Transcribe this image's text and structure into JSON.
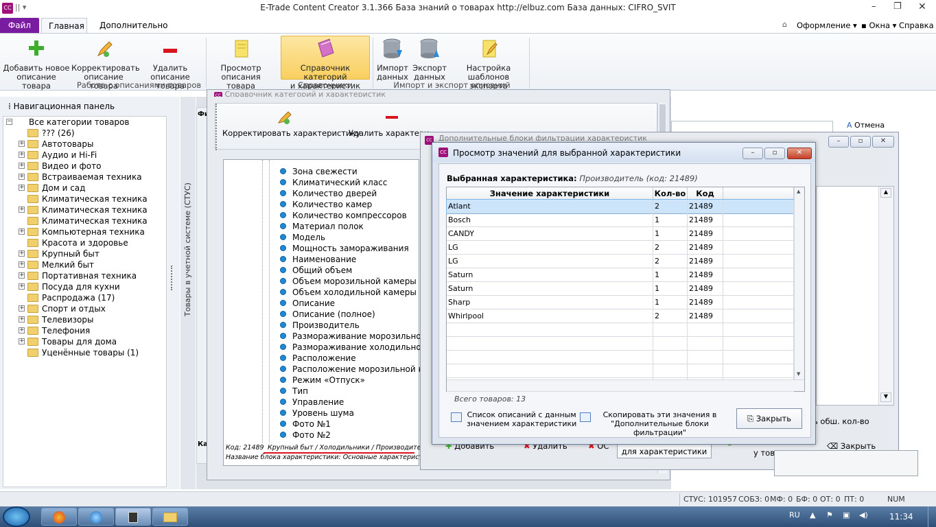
{
  "app": {
    "title": "E-Trade Content Creator 3.1.366     База знаний о товарах     http://elbuz.com     База данных: CIFRO_SVIT",
    "icon_text": "CC"
  },
  "ribbon_tabs": {
    "file": "Файл",
    "main": "Главная",
    "extra": "Дополнительно",
    "right": [
      "Оформление",
      "Окна",
      "Справка"
    ]
  },
  "ribbon": {
    "buttons": [
      {
        "label1": "Добавить новое",
        "label2": "описание товара",
        "icon": "plus-icon"
      },
      {
        "label1": "Корректировать",
        "label2": "описание товара",
        "icon": "pencil-icon"
      },
      {
        "label1": "Удалить",
        "label2": "описание товара",
        "icon": "minus-icon"
      },
      {
        "label1": "Просмотр",
        "label2": "описания товара",
        "icon": "document-icon"
      },
      {
        "label1": "Справочник категорий",
        "label2": "и характеристик",
        "icon": "book-icon"
      },
      {
        "label1": "Импорт",
        "label2": "данных",
        "icon": "database-import-icon"
      },
      {
        "label1": "Экспорт",
        "label2": "данных",
        "icon": "database-export-icon"
      },
      {
        "label1": "Настройка",
        "label2": "шаблонов экспорта",
        "icon": "template-icon"
      }
    ],
    "groups": [
      "Работа с описаниями товаров",
      "Справочники",
      "Импорт и экспорт описаний"
    ]
  },
  "nav": {
    "title": "Навигационная панель",
    "root": "Все категории товаров",
    "items": [
      {
        "label": "??? (26)",
        "expandable": false
      },
      {
        "label": "Автотовары",
        "expandable": true
      },
      {
        "label": "Аудио и Hi-Fi",
        "expandable": true
      },
      {
        "label": "Видео и фото",
        "expandable": true
      },
      {
        "label": "Встраиваемая техника",
        "expandable": true
      },
      {
        "label": "Дом и сад",
        "expandable": true
      },
      {
        "label": "Климатическая техника",
        "expandable": false
      },
      {
        "label": "Климатическая техника",
        "expandable": true
      },
      {
        "label": "Климатическая техника",
        "expandable": false
      },
      {
        "label": "Компьютерная техника",
        "expandable": true
      },
      {
        "label": "Красота и здоровье",
        "expandable": false
      },
      {
        "label": "Крупный быт",
        "expandable": true
      },
      {
        "label": "Мелкий быт",
        "expandable": true
      },
      {
        "label": "Портативная техника",
        "expandable": true
      },
      {
        "label": "Посуда для кухни",
        "expandable": true
      },
      {
        "label": "Распродажа (17)",
        "expandable": false
      },
      {
        "label": "Спорт и отдых",
        "expandable": true
      },
      {
        "label": "Телевизоры",
        "expandable": true
      },
      {
        "label": "Телефония",
        "expandable": true
      },
      {
        "label": "Товары для дома",
        "expandable": true
      },
      {
        "label": "Уценённые товары (1)",
        "expandable": false
      }
    ],
    "vertical_label": "Товары в учетной системе (СТУС)"
  },
  "sprav": {
    "title": "Справочник категорий и характеристик",
    "toolbar": [
      "Корректировать характеристику",
      "Удалить характери"
    ],
    "items": [
      "Зона свежести",
      "Климатический класс",
      "Количество дверей",
      "Количество камер",
      "Количество компрессоров",
      "Материал полок",
      "Модель",
      "Мощность замораживания",
      "Наименование",
      "Общий объем",
      "Объем морозильной камеры",
      "Объем холодильной камеры",
      "Описание",
      "Описание (полное)",
      "Производитель",
      "Размораживание морозильной к",
      "Размораживание холодильной к",
      "Расположение",
      "Расположение морозильной кам",
      "Режим «Отпуск»",
      "Тип",
      "Управление",
      "Уровень шума",
      "Фото №1",
      "Фото №2"
    ],
    "footer_code": "Код: 21489",
    "footer_path": "Крупный быт / Холодильники / Производитель",
    "footer_block": "Название блока характеристики: Основные характеристики"
  },
  "dop": {
    "title": "Дополнительные блоки фильтрации характеристик",
    "cancel": "Отмена",
    "total_label": "ь обш. кол-во",
    "buttons": [
      "Добавить",
      "Удалить",
      "ОС",
      "для характеристики",
      "у товаров",
      "Закрыть"
    ],
    "left_labels": [
      "Фи",
      "Ка"
    ]
  },
  "dialog": {
    "title": "Просмотр значений для выбранной характеристики",
    "selected_label": "Выбранная характеристика:",
    "selected_value": "Производитель (код: 21489)",
    "columns": [
      "Значение характеристики",
      "Кол-во",
      "Код"
    ],
    "rows": [
      [
        "Atlant",
        "2",
        "21489"
      ],
      [
        "Bosch",
        "1",
        "21489"
      ],
      [
        "CANDY",
        "1",
        "21489"
      ],
      [
        "LG",
        "2",
        "21489"
      ],
      [
        "LG",
        "2",
        "21489"
      ],
      [
        "Saturn",
        "1",
        "21489"
      ],
      [
        "Saturn",
        "1",
        "21489"
      ],
      [
        "Sharp",
        "1",
        "21489"
      ],
      [
        "Whirlpool",
        "2",
        "21489"
      ]
    ],
    "total": "Всего товаров: 13",
    "btn_list_1": "Список описаний с данным",
    "btn_list_2": "значением характеристики",
    "btn_copy_1": "Скопировать эти значения в",
    "btn_copy_2": "\"Дополнительные блоки фильтрации\"",
    "btn_close": "Закрыть"
  },
  "status": {
    "items": [
      "СТУС: 101957",
      "СОБЗ: 0",
      "МФ: 0",
      "БФ: 0",
      "ОТ: 0",
      "ПТ: 0",
      "NUM"
    ]
  },
  "taskbar": {
    "lang": "RU",
    "time": "11:34"
  },
  "colors": {
    "accent": "#7a1ca0",
    "selected_row": "#cce5fb",
    "ribbon_highlight": "#fbd878",
    "annotation_line": "#d8151f"
  }
}
